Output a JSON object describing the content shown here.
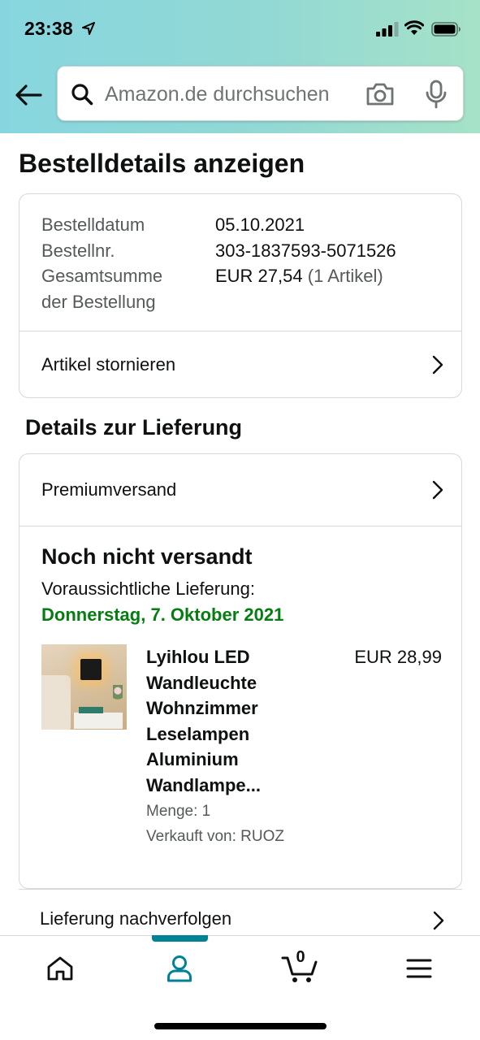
{
  "status_bar": {
    "time": "23:38"
  },
  "search": {
    "placeholder": "Amazon.de durchsuchen"
  },
  "page_title": "Bestelldetails anzeigen",
  "order_summary": {
    "date_label": "Bestelldatum",
    "date_value": "05.10.2021",
    "number_label": "Bestellnr.",
    "number_value": "303-1837593-5071526",
    "total_label_line1": "Gesamtsumme",
    "total_label_line2": "der Bestellung",
    "total_value": "EUR 27,54",
    "total_items": "(1 Artikel)",
    "cancel_label": "Artikel stornieren"
  },
  "delivery": {
    "section_title": "Details zur Lieferung",
    "shipping_method": "Premiumversand",
    "status": "Noch nicht versandt",
    "expected_label": "Voraussichtliche Lieferung:",
    "expected_date": "Donnerstag, 7. Oktober 2021",
    "product": {
      "title": "Lyihlou LED Wandleuchte Wohnzimmer Leselampen Aluminium Wandlampe...",
      "price": "EUR 28,99",
      "quantity": "Menge: 1",
      "seller": "Verkauft von: RUOZ"
    },
    "track_label": "Lieferung nachverfolgen"
  },
  "bottom_nav": {
    "active": "account",
    "cart_count": "0",
    "items": [
      "home",
      "account",
      "cart",
      "menu"
    ]
  },
  "colors": {
    "header_gradient_start": "#87d6df",
    "header_gradient_end": "#a6e2c8",
    "delivery_green": "#067d10",
    "nav_accent": "#008296"
  },
  "icons": {
    "back": "arrow-left-icon",
    "search": "search-icon",
    "camera": "camera-icon",
    "mic": "microphone-icon",
    "chevron": "chevron-right-icon",
    "home": "home-icon",
    "account": "person-icon",
    "cart": "cart-icon",
    "menu": "hamburger-menu-icon"
  }
}
